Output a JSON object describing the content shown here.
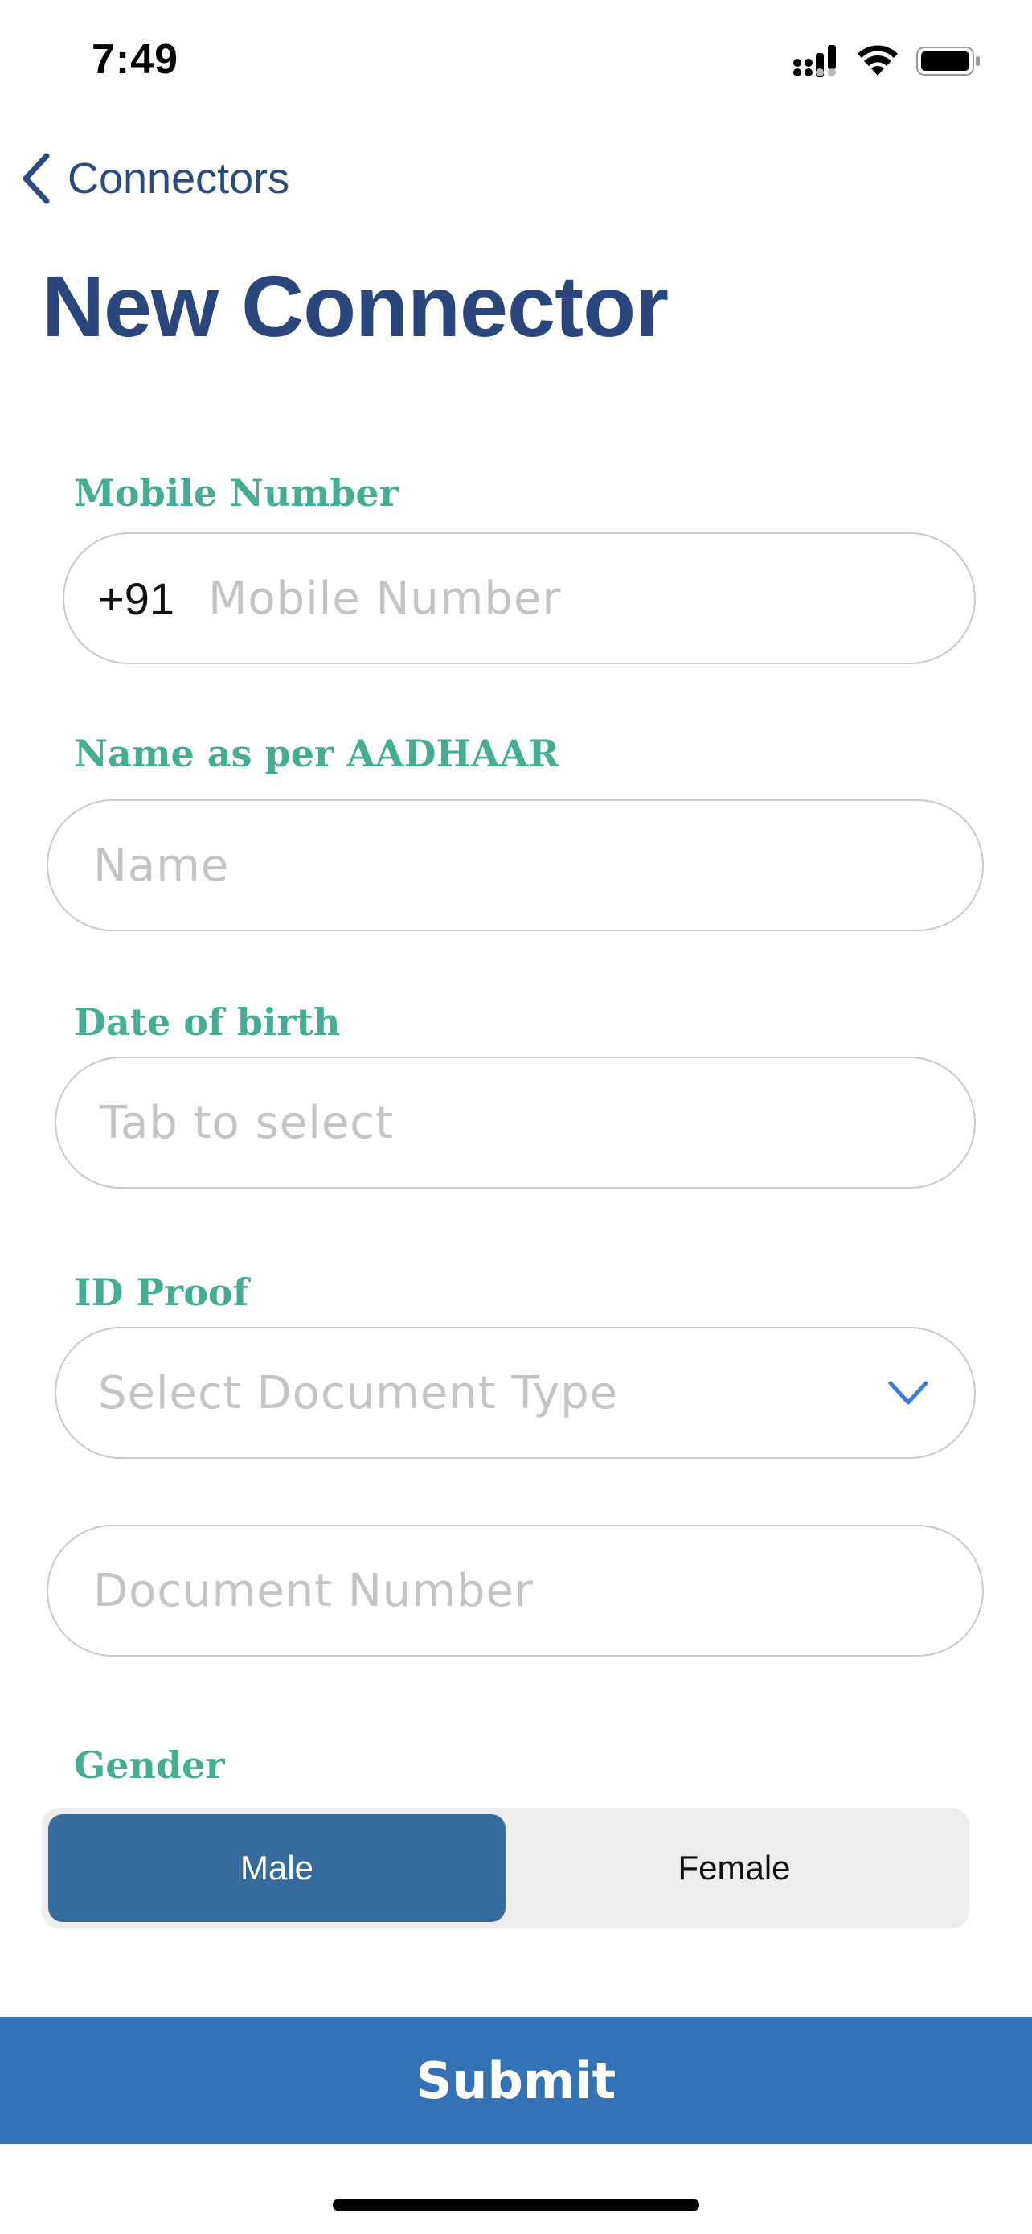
{
  "status_bar": {
    "time": "7:49"
  },
  "nav": {
    "back_label": "Connectors"
  },
  "page": {
    "title": "New Connector"
  },
  "form": {
    "mobile": {
      "label": "Mobile Number",
      "prefix": "+91",
      "placeholder": "Mobile Number",
      "value": ""
    },
    "name": {
      "label": "Name as per AADHAAR",
      "placeholder": "Name",
      "value": ""
    },
    "dob": {
      "label": "Date of birth",
      "placeholder": "Tab to select",
      "value": ""
    },
    "id_proof": {
      "label": "ID Proof",
      "selected_text": "Select Document Type"
    },
    "document_number": {
      "placeholder": "Document Number",
      "value": ""
    },
    "gender": {
      "label": "Gender",
      "options": [
        "Male",
        "Female"
      ],
      "selected": "Male"
    }
  },
  "actions": {
    "submit_label": "Submit"
  },
  "colors": {
    "title": "#2b467c",
    "label": "#45ad93",
    "segment_active": "#356b9d",
    "submit": "#3372b5",
    "chevron": "#3b7be0"
  },
  "icons": {
    "back": "chevron-left-icon",
    "dropdown": "chevron-down-icon",
    "signal": "cellular-signal-icon",
    "wifi": "wifi-icon",
    "battery": "battery-icon"
  }
}
